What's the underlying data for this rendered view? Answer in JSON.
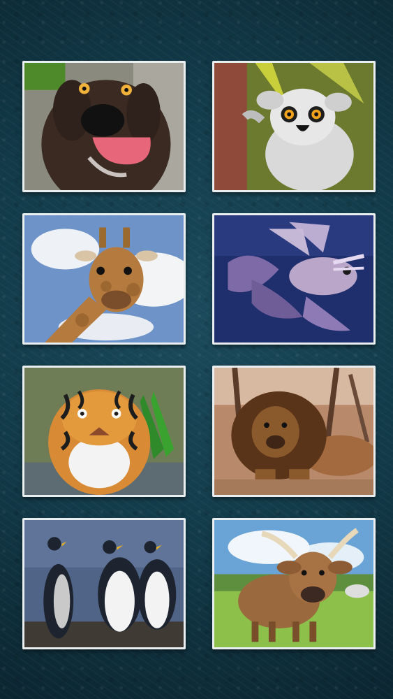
{
  "gallery": {
    "tiles": [
      {
        "icon": "dog-icon",
        "colors": {
          "bg": "#8a8a7e",
          "subject": "#3a2a22",
          "accent": "#e8667a"
        }
      },
      {
        "icon": "lemur-icon",
        "colors": {
          "bg": "#6b7a2e",
          "subject": "#d9d9d9",
          "accent": "#f0a21a"
        }
      },
      {
        "icon": "giraffe-icon",
        "colors": {
          "bg": "#6d93c9",
          "subject": "#b57a3e",
          "accent": "#f3f4f6"
        }
      },
      {
        "icon": "lionfish-icon",
        "colors": {
          "bg": "#1f2f6e",
          "subject": "#b9a6c9",
          "accent": "#7d6aa6"
        }
      },
      {
        "icon": "tiger-icon",
        "colors": {
          "bg": "#6f7d57",
          "subject": "#d98a35",
          "accent": "#1d1d1d"
        }
      },
      {
        "icon": "lion-icon",
        "colors": {
          "bg": "#b9896b",
          "subject": "#8b5a2c",
          "accent": "#5a3418"
        }
      },
      {
        "icon": "penguin-icon",
        "colors": {
          "bg": "#4f6486",
          "subject": "#f3f3f3",
          "accent": "#1d2430"
        }
      },
      {
        "icon": "cow-icon",
        "colors": {
          "bg": "#8cc04a",
          "subject": "#9a6a3e",
          "accent": "#6aa3d6"
        }
      }
    ]
  }
}
